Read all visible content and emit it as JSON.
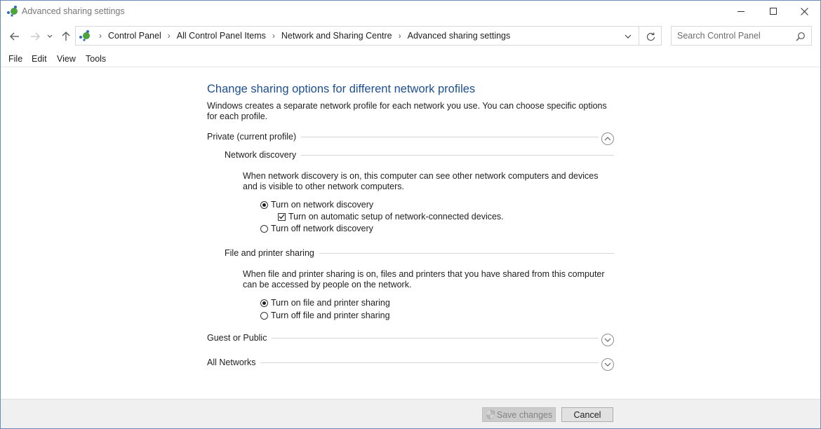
{
  "window": {
    "title": "Advanced sharing settings",
    "icon": "network-sharing-icon"
  },
  "address": {
    "breadcrumbs": [
      "Control Panel",
      "All Control Panel Items",
      "Network and Sharing Centre",
      "Advanced sharing settings"
    ]
  },
  "search": {
    "placeholder": "Search Control Panel"
  },
  "menu": {
    "items": [
      "File",
      "Edit",
      "View",
      "Tools"
    ]
  },
  "content": {
    "heading": "Change sharing options for different network profiles",
    "intro": "Windows creates a separate network profile for each network you use. You can choose specific options for each profile.",
    "private_profile": {
      "label": "Private (current profile)",
      "expanded": true,
      "network_discovery": {
        "label": "Network discovery",
        "description": "When network discovery is on, this computer can see other network computers and devices and is visible to other network computers.",
        "on_label": "Turn on network discovery",
        "on_selected": true,
        "auto_setup_label": "Turn on automatic setup of network-connected devices.",
        "auto_setup_checked": true,
        "off_label": "Turn off network discovery",
        "off_selected": false
      },
      "file_printer_sharing": {
        "label": "File and printer sharing",
        "description": "When file and printer sharing is on, files and printers that you have shared from this computer can be accessed by people on the network.",
        "on_label": "Turn on file and printer sharing",
        "on_selected": true,
        "off_label": "Turn off file and printer sharing",
        "off_selected": false
      }
    },
    "guest_public": {
      "label": "Guest or Public",
      "expanded": false
    },
    "all_networks": {
      "label": "All Networks",
      "expanded": false
    }
  },
  "footer": {
    "save_label": "Save changes",
    "save_enabled": false,
    "cancel_label": "Cancel"
  },
  "colors": {
    "heading": "#1d4f91",
    "accent": "#4aa33b"
  }
}
